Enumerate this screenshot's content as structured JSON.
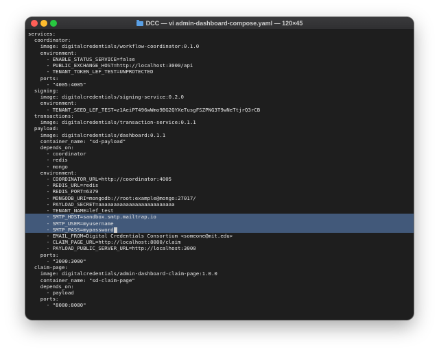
{
  "window": {
    "title": "DCC — vi admin-dashboard-compose.yaml — 120×45"
  },
  "icons": {
    "title_icon": "folder-icon"
  },
  "colors": {
    "close": "#ff5f57",
    "minimize": "#febc2e",
    "maximize": "#28c840",
    "terminal_bg": "#1e1e1e",
    "selection": "#42597a"
  },
  "editor": {
    "lines": [
      "services:",
      "  coordinator:",
      "    image: digitalcredentials/workflow-coordinator:0.1.0",
      "    environment:",
      "      - ENABLE_STATUS_SERVICE=false",
      "      - PUBLIC_EXCHANGE_HOST=http://localhost:3000/api",
      "      - TENANT_TOKEN_LEF_TEST=UNPROTECTED",
      "    ports:",
      "      - \"4005:4005\"",
      "  signing:",
      "    image: digitalcredentials/signing-service:0.2.0",
      "    environment:",
      "      - TENANT_SEED_LEF_TEST=z1AeiPT496wWmo9BG2QYXeTusgFSZPNG3T9wNeTtjrQ3rCB",
      "  transactions:",
      "    image: digitalcredentials/transaction-service:0.1.1",
      "  payload:",
      "    image: digitalcredentials/dashboard:0.1.1",
      "    container_name: \"sd-payload\"",
      "    depends_on:",
      "      - coordinator",
      "      - redis",
      "      - mongo",
      "    environment:",
      "      - COORDINATOR_URL=http://coordinator:4005",
      "      - REDIS_URL=redis",
      "      - REDIS_PORT=6379",
      "      - MONGODB_URI=mongodb://root:example@mongo:27017/",
      "      - PAYLOAD_SECRET=aaaaaaaaaaaaaaaaaaaaaaaaa",
      "      - TENANT_NAME=lef_test",
      "      - SMTP_HOST=sandbox.smtp.mailtrap.io",
      "      - SMTP_USER=myusername",
      "      - SMTP_PASS=mypassword",
      "      - EMAIL_FROM=Digital Credentials Consortium <someone@mit.edu>",
      "      - CLAIM_PAGE_URL=http://localhost:8080/claim",
      "      - PAYLOAD_PUBLIC_SERVER_URL=http://localhost:3000",
      "    ports:",
      "      - \"3000:3000\"",
      "  claim-page:",
      "    image: digitalcredentials/admin-dashboard-claim-page:1.0.0",
      "    container_name: \"sd-claim-page\"",
      "    depends_on:",
      "      - payload",
      "    ports:",
      "      - \"8080:8080\""
    ],
    "selected_lines": [
      29,
      30,
      31
    ],
    "cursor_line": 31
  }
}
